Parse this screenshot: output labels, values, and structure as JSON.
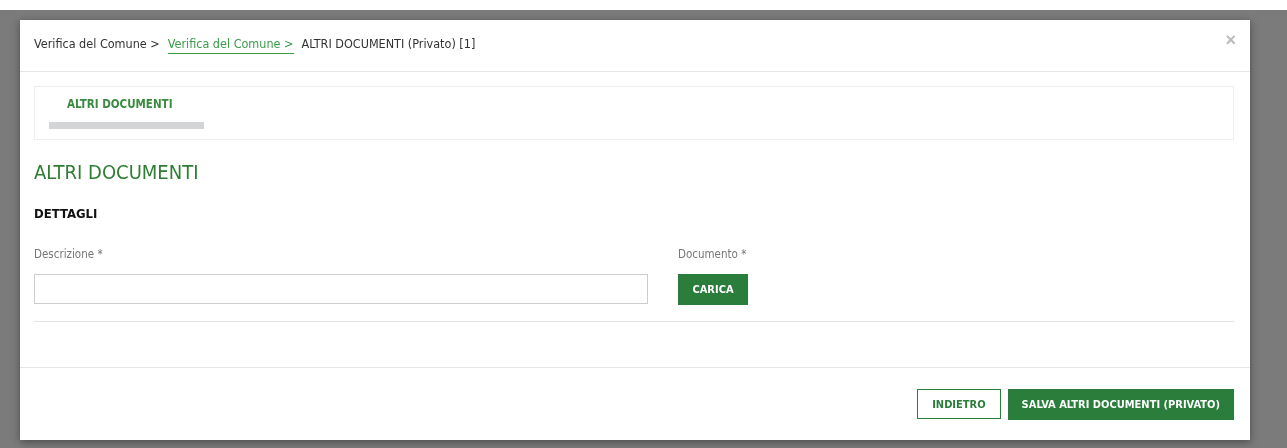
{
  "breadcrumb": [
    {
      "label": "Verifica del Comune >",
      "kind": "plain"
    },
    {
      "label": "Verifica del Comune >",
      "kind": "link"
    },
    {
      "label": "ALTRI DOCUMENTI (Privato) [1]",
      "kind": "current"
    }
  ],
  "close": "×",
  "steps": [
    {
      "label": "ALTRI DOCUMENTI",
      "selected": true
    }
  ],
  "title": "ALTRI DOCUMENTI",
  "section": "DETTAGLI",
  "fields": [
    {
      "label": "Descrizione *",
      "kind": "text"
    },
    {
      "label": "Documento *",
      "kind": "upload",
      "button": "CARICA"
    }
  ],
  "buttons": [
    {
      "label": "INDIETRO",
      "kind": "secondary"
    },
    {
      "label": "SALVA ALTRI DOCUMENTI (PRIVATO)",
      "kind": "primary"
    }
  ]
}
